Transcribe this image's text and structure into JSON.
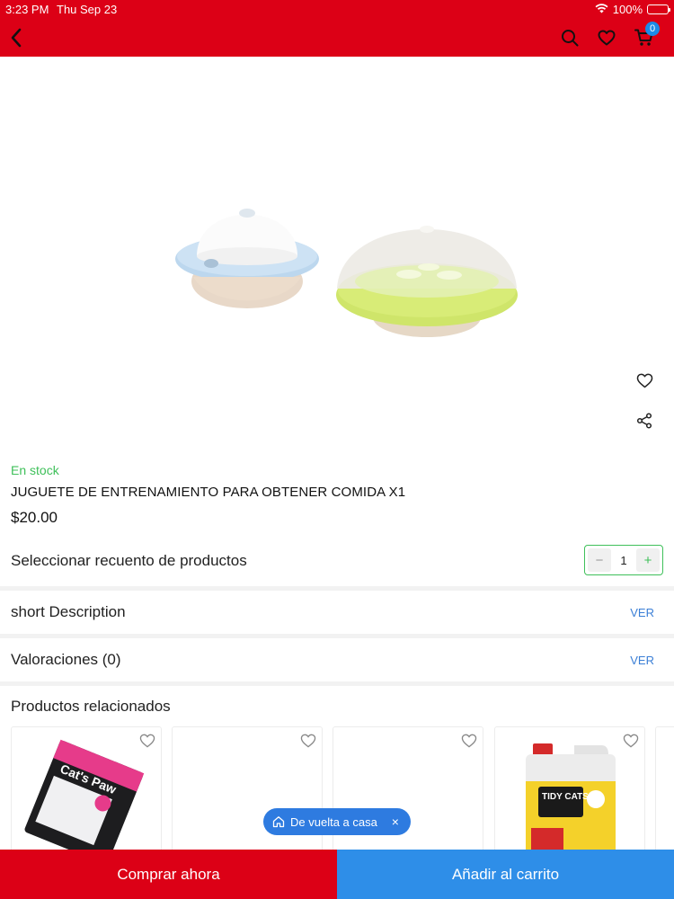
{
  "status_bar": {
    "time": "3:23 PM",
    "date": "Thu Sep 23",
    "battery": "100%"
  },
  "header": {
    "cart_count": "0",
    "icons": [
      "back-icon",
      "search-icon",
      "heart-icon",
      "cart-icon"
    ]
  },
  "product": {
    "stock": "En stock",
    "title": "JUGUETE DE ENTRENAMIENTO PARA OBTENER COMIDA X1",
    "price": "$20.00",
    "quantity_label": "Seleccionar recuento de productos",
    "quantity": "1",
    "minus": "−",
    "plus": "+"
  },
  "sections": {
    "description": {
      "label": "short Description",
      "link": "VER"
    },
    "reviews": {
      "label": "Valoraciones (0)",
      "link": "VER"
    }
  },
  "related": {
    "title": "Productos relacionados",
    "items": [
      "Cat's Paw",
      "",
      "",
      "TIDY CATS"
    ]
  },
  "chip": {
    "label": "De vuelta a casa",
    "close": "×"
  },
  "actions": {
    "buy_now": "Comprar ahora",
    "add_to_cart": "Añadir al carrito"
  },
  "colors": {
    "brand_red": "#dc0016",
    "accent_blue": "#2e8ee8",
    "stock_green": "#3fc05a"
  }
}
